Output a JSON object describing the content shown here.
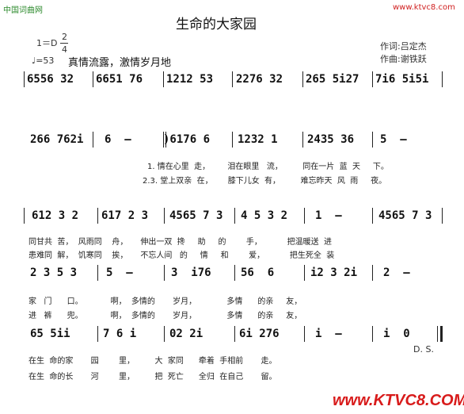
{
  "watermarks": {
    "top_left": "中国词曲网",
    "top_right": "www.ktvc8.com",
    "bottom_right": "www.KTVC8.COM"
  },
  "song": {
    "title": "生命的大家园",
    "key": "1＝D",
    "time_top": "2",
    "time_bottom": "4",
    "tempo": "♩=53",
    "expression": "真情流露，激情岁月地",
    "lyricist": "作词:吕定杰",
    "composer": "作曲:谢铁跃"
  },
  "score": {
    "row1": [
      "6556 32",
      "6651 76",
      "1212 53",
      "2276 32",
      "265 5i27",
      "7i6 5i5i"
    ],
    "row2": [
      "266 762i",
      "6  –",
      ")6176 6",
      "1232 1",
      "2435 36",
      "5  –"
    ],
    "row2_lyrics_1": "1. 情在心里  走，       泪在眼里   流，        同在一片  蓝  天     下。",
    "row2_lyrics_2": "2.3. 堂上双亲  在，      膝下儿女  有，        难忘昨天  风  雨     夜。",
    "row3": [
      "612 3 2",
      "617 2 3",
      "4565 7 3",
      "4 5 3 2",
      "1  –",
      "4565 7 3"
    ],
    "row3_lyrics_1": "同甘共  苦，  风雨同    舟，     伸出一双  搀     助     的        手，          把温暖送  进",
    "row3_lyrics_2": "患难同  解，  饥寒同    挨，     不忘人间   的     情     和        爱，          把生死全  装",
    "row4": [
      "2 3 5 3",
      "5  –",
      "3  i76",
      "56  6",
      "i2 3 2i",
      "2  –"
    ],
    "row4_lyrics_1": "家   门      口。           啊，  多情的       岁月，            多情      的亲     友，",
    "row4_lyrics_2": "进   裤      兜。           啊，  多情的       岁月，            多情      的亲     友，",
    "row5": [
      "65 5ii",
      "7 6 i",
      "02 2i",
      "6i 276",
      "i  –",
      "i  0"
    ],
    "row5_end": "D. S.",
    "row5_lyrics_1": "在生  命的家       园        里，        大  家同      牵着  手相前       走。",
    "row5_lyrics_2": "在生  命的长       河        里，        把  死亡      全归  在自己       留。"
  }
}
